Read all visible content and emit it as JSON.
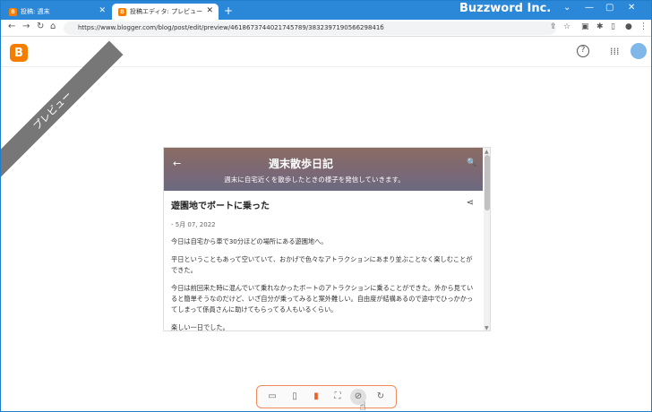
{
  "browser": {
    "tabs": [
      {
        "label": "投稿: 週末",
        "favicon": "blogger-icon"
      },
      {
        "label": "投稿エディタ: プレビュー",
        "favicon": "blogger-icon"
      }
    ],
    "new_tab": "+",
    "brand_watermark": "Buzzword Inc.",
    "url": "https://www.blogger.com/blog/post/edit/preview/4618673744021745789/383239719056629841б"
  },
  "blogger": {
    "logo": "B",
    "ribbon": "プレビュー"
  },
  "preview": {
    "blog_title": "週末散歩日記",
    "blog_subtitle": "週末に自宅近くを散歩したときの様子を発信していきます。",
    "post_title": "遊園地でボートに乗った",
    "post_date": "- 5月 07, 2022",
    "paragraphs": [
      "今日は自宅から車で30分ほどの場所にある遊園地へ。",
      "平日ということもあって空いていて、おかげで色々なアトラクションにあまり並ぶことなく楽しむことができた。",
      "今日は前回来た時に混んでいて乗れなかったボートのアトラクションに乗ることができた。外から見ていると簡単そうなのだけど、いざ自分が乗ってみると案外難しい。自由度が結構あるので途中でひっかかってしまって係員さんに助けてもらってる人もいるくらい。",
      "楽しい一日でした。"
    ]
  },
  "toolbar": {
    "items": [
      "desktop-view",
      "tablet-view",
      "mobile-view",
      "fullscreen",
      "rotate",
      "reload"
    ],
    "active": "mobile-view"
  }
}
